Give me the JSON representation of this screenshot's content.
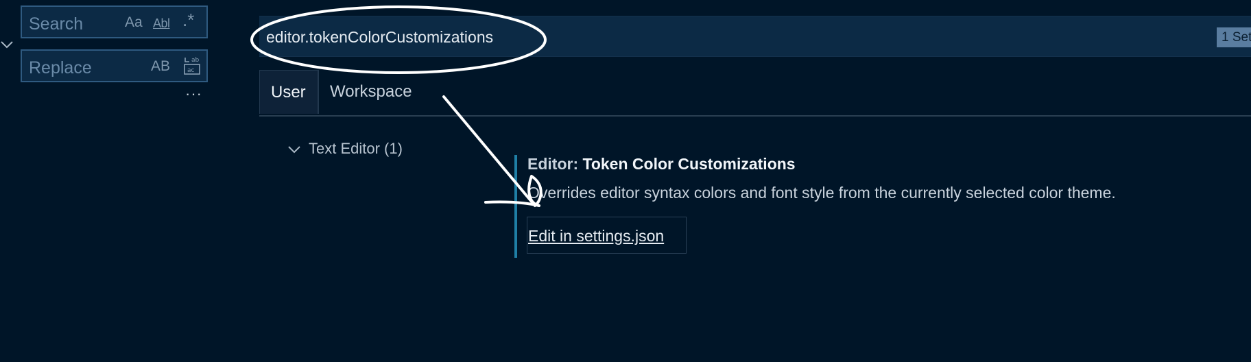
{
  "find_panel": {
    "search_placeholder": "Search",
    "replace_placeholder": "Replace",
    "option_match_case": "Aa",
    "option_whole_word": "Abl",
    "option_regex": ".*",
    "option_preserve_case": "AB",
    "more_actions": "···"
  },
  "settings": {
    "query": "editor.tokenColorCustomizations",
    "result_count": "1 Set",
    "tabs": [
      {
        "label": "User"
      },
      {
        "label": "Workspace"
      }
    ],
    "toc": {
      "label": "Text Editor (1)"
    },
    "item": {
      "category": "Editor: ",
      "name": "Token Color Customizations",
      "description": "Overrides editor syntax colors and font style from the currently selected color theme.",
      "edit_link": "Edit in settings.json"
    }
  },
  "colors": {
    "background": "#001528",
    "input_background": "#0c2a45",
    "accent_bar": "#1f7fa6",
    "badge": "#5a7da0",
    "annotation": "#ffffff"
  }
}
